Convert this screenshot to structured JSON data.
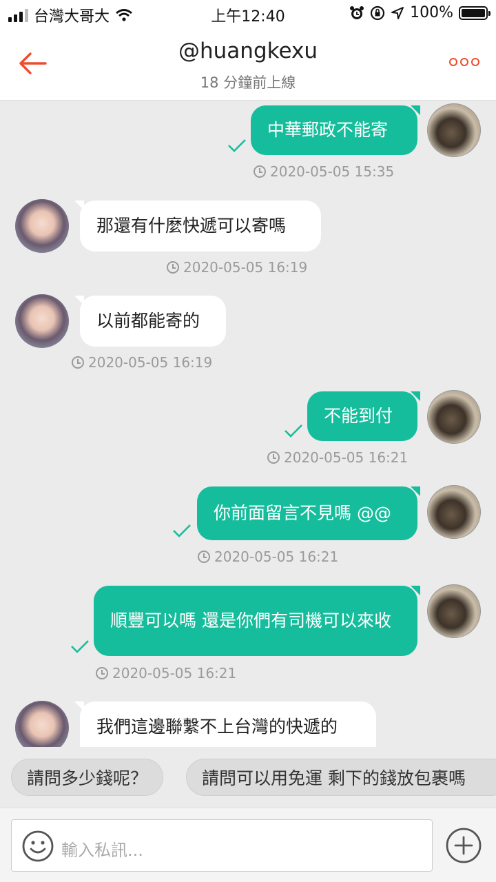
{
  "status_bar": {
    "carrier": "台灣大哥大",
    "time": "上午12:40",
    "battery": "100%",
    "battery_level": 1.0
  },
  "header": {
    "title": "@huangkexu",
    "subtitle": "18 分鐘前上線"
  },
  "messages": [
    {
      "from": "me",
      "text": "中華郵政不能寄",
      "time": "2020-05-05 15:35",
      "read": true
    },
    {
      "from": "them",
      "text": "那還有什麼快遞可以寄嗎",
      "time": "2020-05-05 16:19"
    },
    {
      "from": "them",
      "text": "以前都能寄的",
      "time": "2020-05-05 16:19"
    },
    {
      "from": "me",
      "text": "不能到付",
      "time": "2020-05-05 16:21",
      "read": true
    },
    {
      "from": "me",
      "text": "你前面留言不見嗎 @@",
      "time": "2020-05-05 16:21",
      "read": true
    },
    {
      "from": "me",
      "text": "順豐可以嗎 還是你們有司機可以來收",
      "time": "2020-05-05 16:21",
      "read": true
    },
    {
      "from": "them",
      "text": "我們這邊聯繫不上台灣的快遞的",
      "time": ""
    }
  ],
  "quick_replies": [
    "請問多少錢呢？",
    "請問可以用免運 剩下的錢放包裹嗎"
  ],
  "input": {
    "placeholder": "輸入私訊..."
  },
  "colors": {
    "accent": "#ee4d2d",
    "bubble_out": "#16bd9c",
    "bubble_in": "#ffffff",
    "background": "#ebebeb"
  },
  "icons": [
    "back-arrow-icon",
    "more-dots-icon",
    "read-check-icon",
    "clock-icon",
    "smiley-icon",
    "plus-circle-icon",
    "wifi-icon",
    "alarm-icon",
    "location-icon"
  ]
}
